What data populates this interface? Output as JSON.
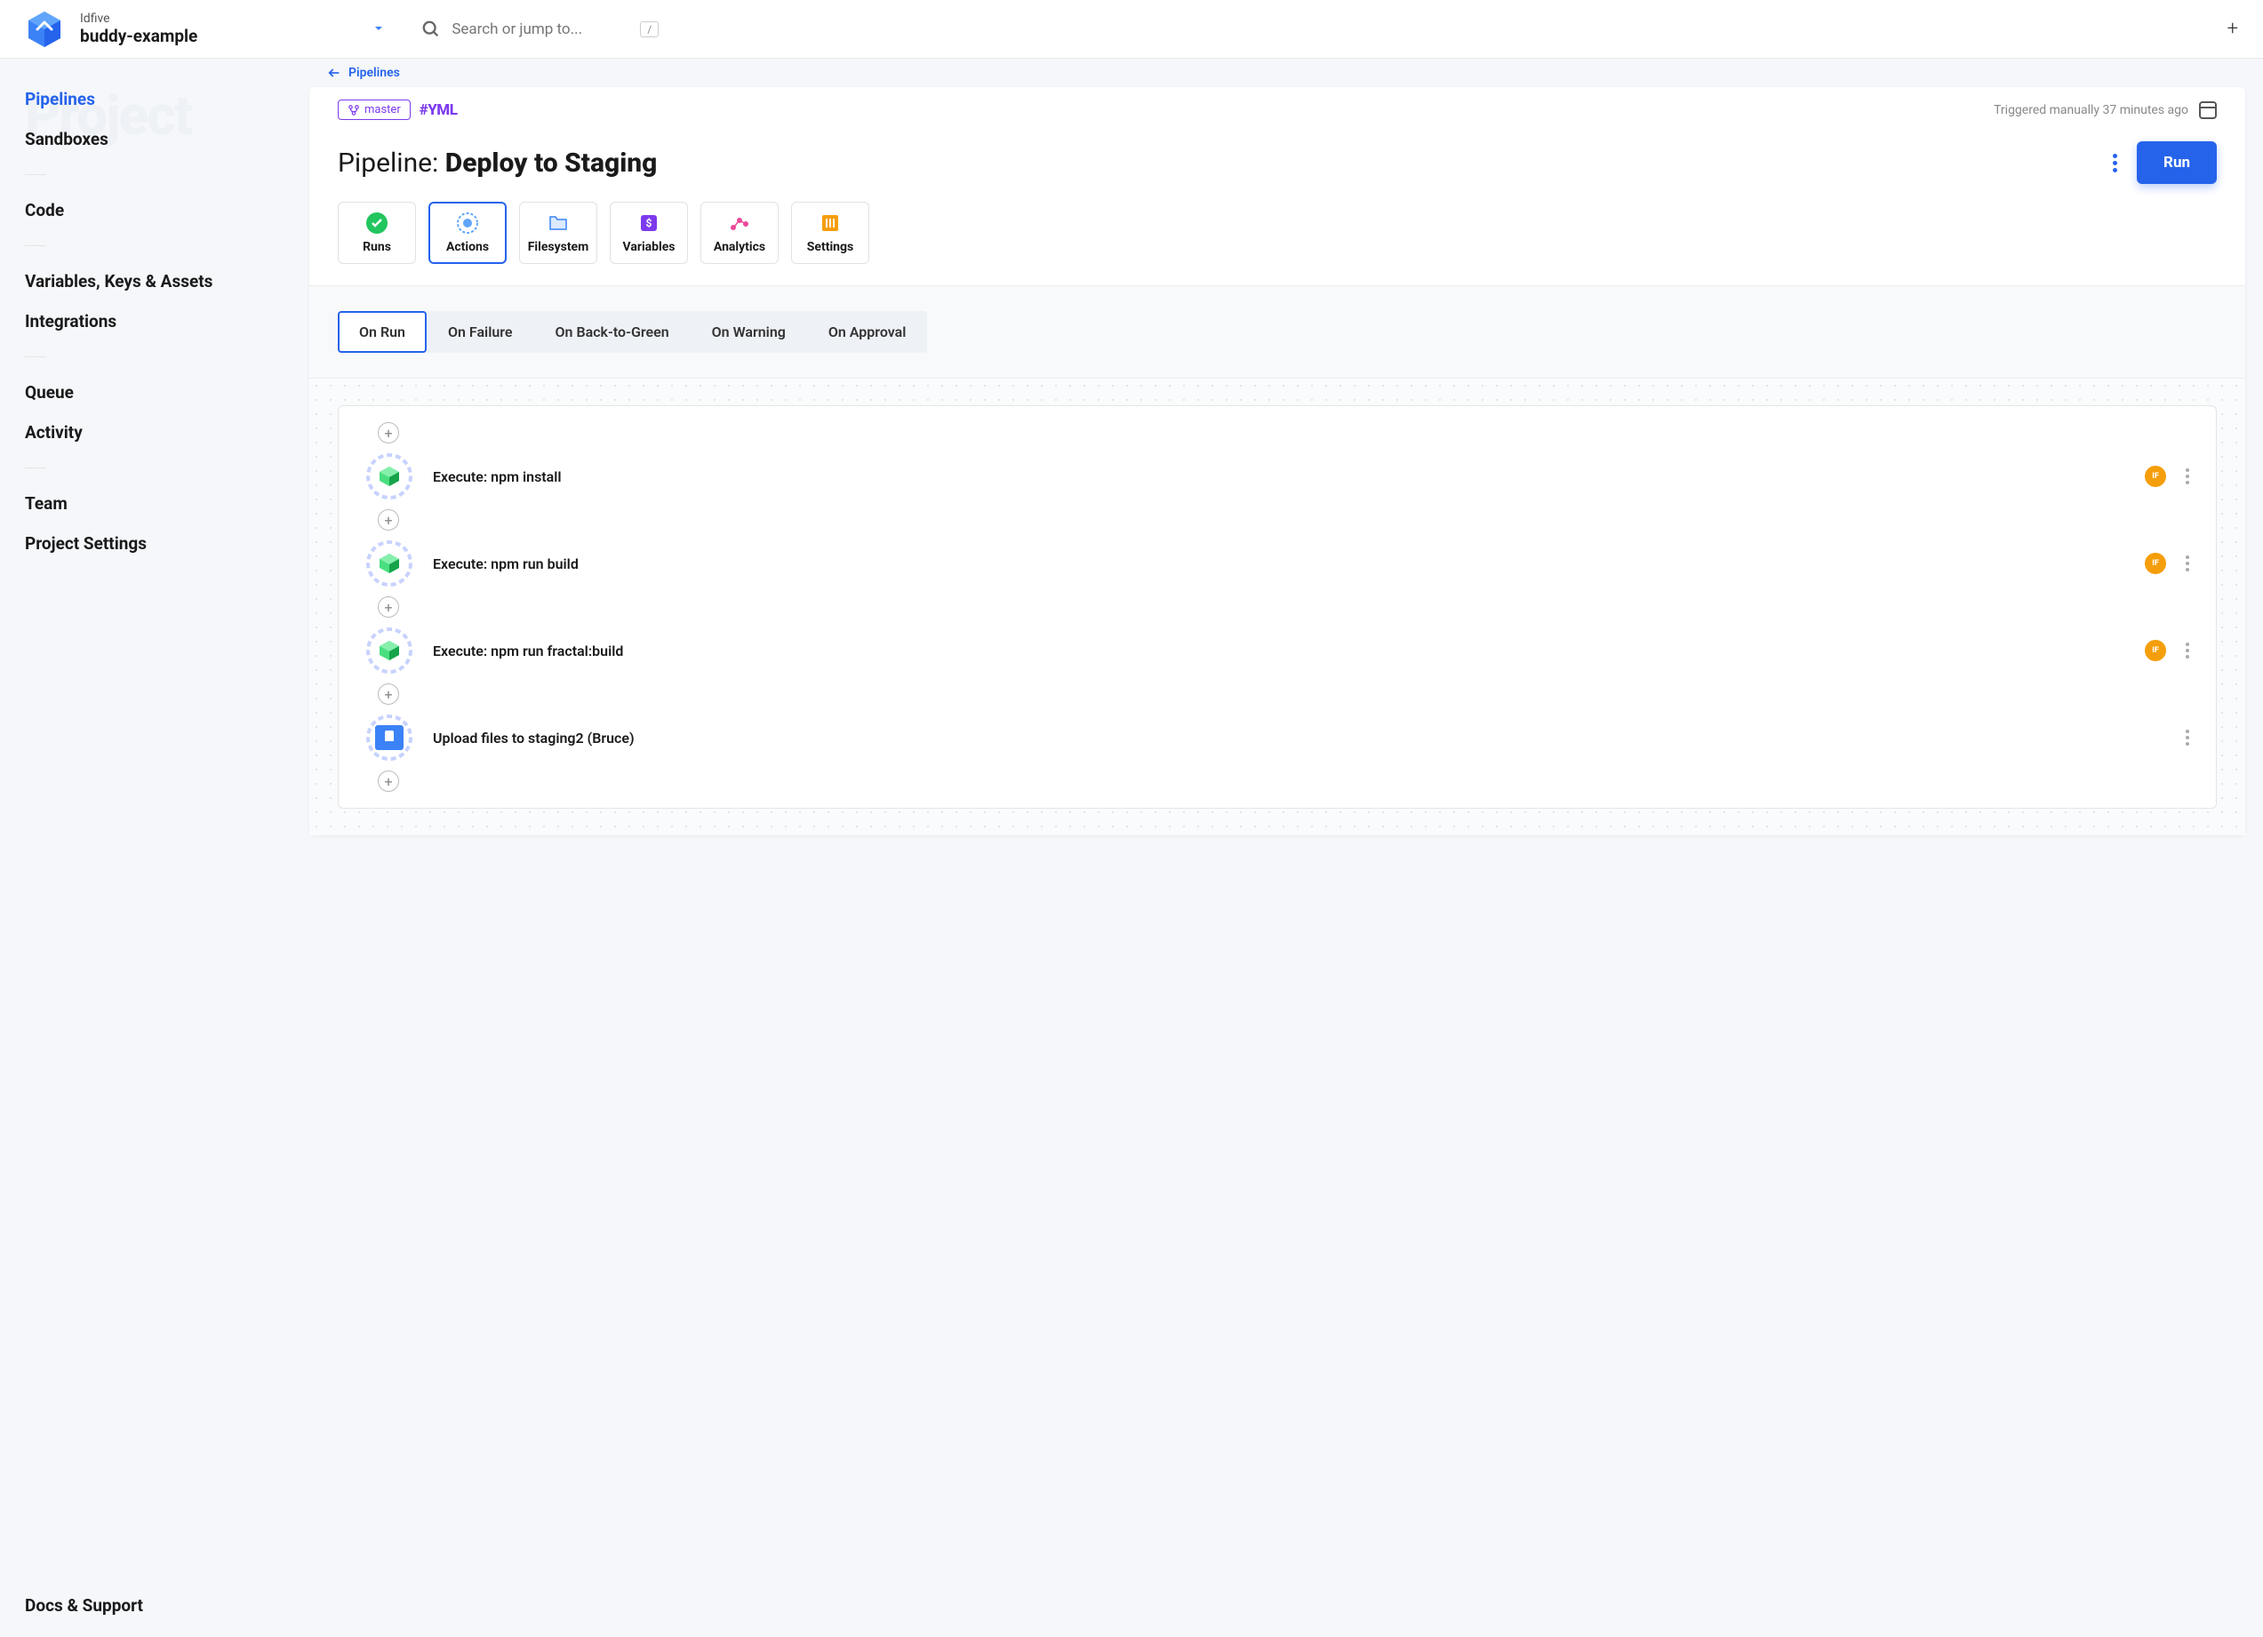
{
  "header": {
    "org": "Idfive",
    "project": "buddy-example",
    "search_placeholder": "Search or jump to...",
    "search_key": "/"
  },
  "sidebar": {
    "bg_text": "Project",
    "items": [
      {
        "label": "Pipelines",
        "active": true
      },
      {
        "label": "Sandboxes",
        "active": false
      }
    ],
    "items2": [
      {
        "label": "Code"
      }
    ],
    "items3": [
      {
        "label": "Variables, Keys & Assets"
      },
      {
        "label": "Integrations"
      }
    ],
    "items4": [
      {
        "label": "Queue"
      },
      {
        "label": "Activity"
      }
    ],
    "items5": [
      {
        "label": "Team"
      },
      {
        "label": "Project Settings"
      }
    ],
    "footer": "Docs & Support"
  },
  "breadcrumb": {
    "label": "Pipelines"
  },
  "pipeline": {
    "branch": "master",
    "yml": "#YML",
    "trigger_text": "Triggered manually 37 minutes ago",
    "title_prefix": "Pipeline: ",
    "title_name": "Deploy to Staging",
    "run_label": "Run"
  },
  "tabs": [
    {
      "label": "Runs",
      "icon": "check"
    },
    {
      "label": "Actions",
      "icon": "gear",
      "active": true
    },
    {
      "label": "Filesystem",
      "icon": "folder"
    },
    {
      "label": "Variables",
      "icon": "var"
    },
    {
      "label": "Analytics",
      "icon": "analytics"
    },
    {
      "label": "Settings",
      "icon": "settings"
    }
  ],
  "subtabs": [
    {
      "label": "On Run",
      "active": true
    },
    {
      "label": "On Failure"
    },
    {
      "label": "On Back-to-Green"
    },
    {
      "label": "On Warning"
    },
    {
      "label": "On Approval"
    }
  ],
  "actions": [
    {
      "label": "Execute: npm install",
      "icon": "node",
      "if": true
    },
    {
      "label": "Execute: npm run build",
      "icon": "node",
      "if": true
    },
    {
      "label": "Execute: npm run fractal:build",
      "icon": "node",
      "if": true
    },
    {
      "label": "Upload files to staging2 (Bruce)",
      "icon": "sftp",
      "if": false
    }
  ],
  "if_badge": "IF"
}
